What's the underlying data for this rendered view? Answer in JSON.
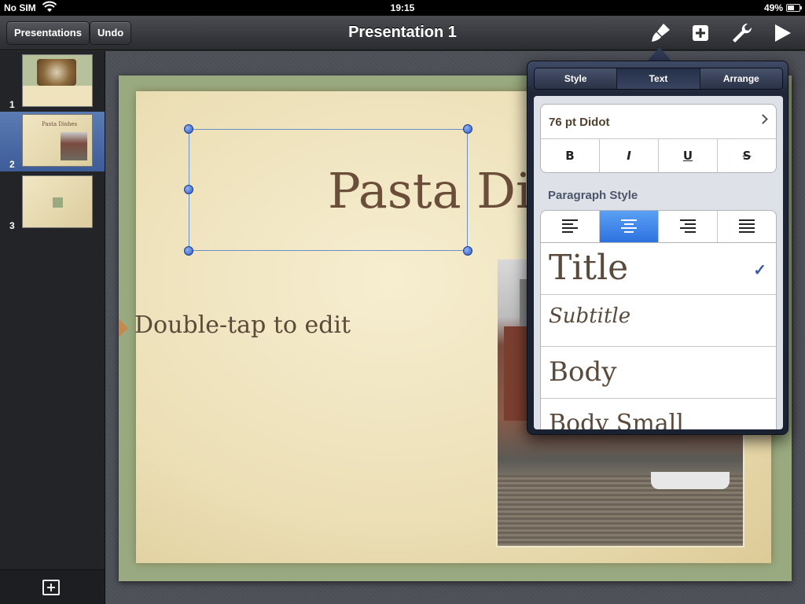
{
  "status_bar": {
    "carrier": "No SIM",
    "time": "19:15",
    "battery": "49%",
    "battery_level": 0.49
  },
  "toolbar": {
    "presentations_label": "Presentations",
    "undo_label": "Undo",
    "title": "Presentation 1",
    "icons": [
      "paintbrush-icon",
      "insert-icon",
      "wrench-icon",
      "play-icon"
    ]
  },
  "sidebar": {
    "slides": [
      {
        "number": "1",
        "title": ""
      },
      {
        "number": "2",
        "title": "Pasta Dishes"
      },
      {
        "number": "3",
        "title": ""
      }
    ],
    "selected_index": 1
  },
  "slide": {
    "title": "Pasta Disl",
    "placeholder": "Double-tap to edit"
  },
  "popover": {
    "tabs": [
      "Style",
      "Text",
      "Arrange"
    ],
    "active_tab": "Text",
    "font": "76 pt Didot",
    "style_buttons": [
      "B",
      "I",
      "U",
      "S"
    ],
    "paragraph_header": "Paragraph Style",
    "alignment_active": "center",
    "paragraph_styles": [
      {
        "label": "Title",
        "checked": true
      },
      {
        "label": "Subtitle",
        "checked": false
      },
      {
        "label": "Body",
        "checked": false
      },
      {
        "label": "Body Small",
        "checked": false
      }
    ],
    "checkmark": "✓"
  },
  "colors": {
    "accent_blue": "#2e72e0",
    "title_brown": "#6a4e3a",
    "slide_green": "#9aaa80"
  }
}
